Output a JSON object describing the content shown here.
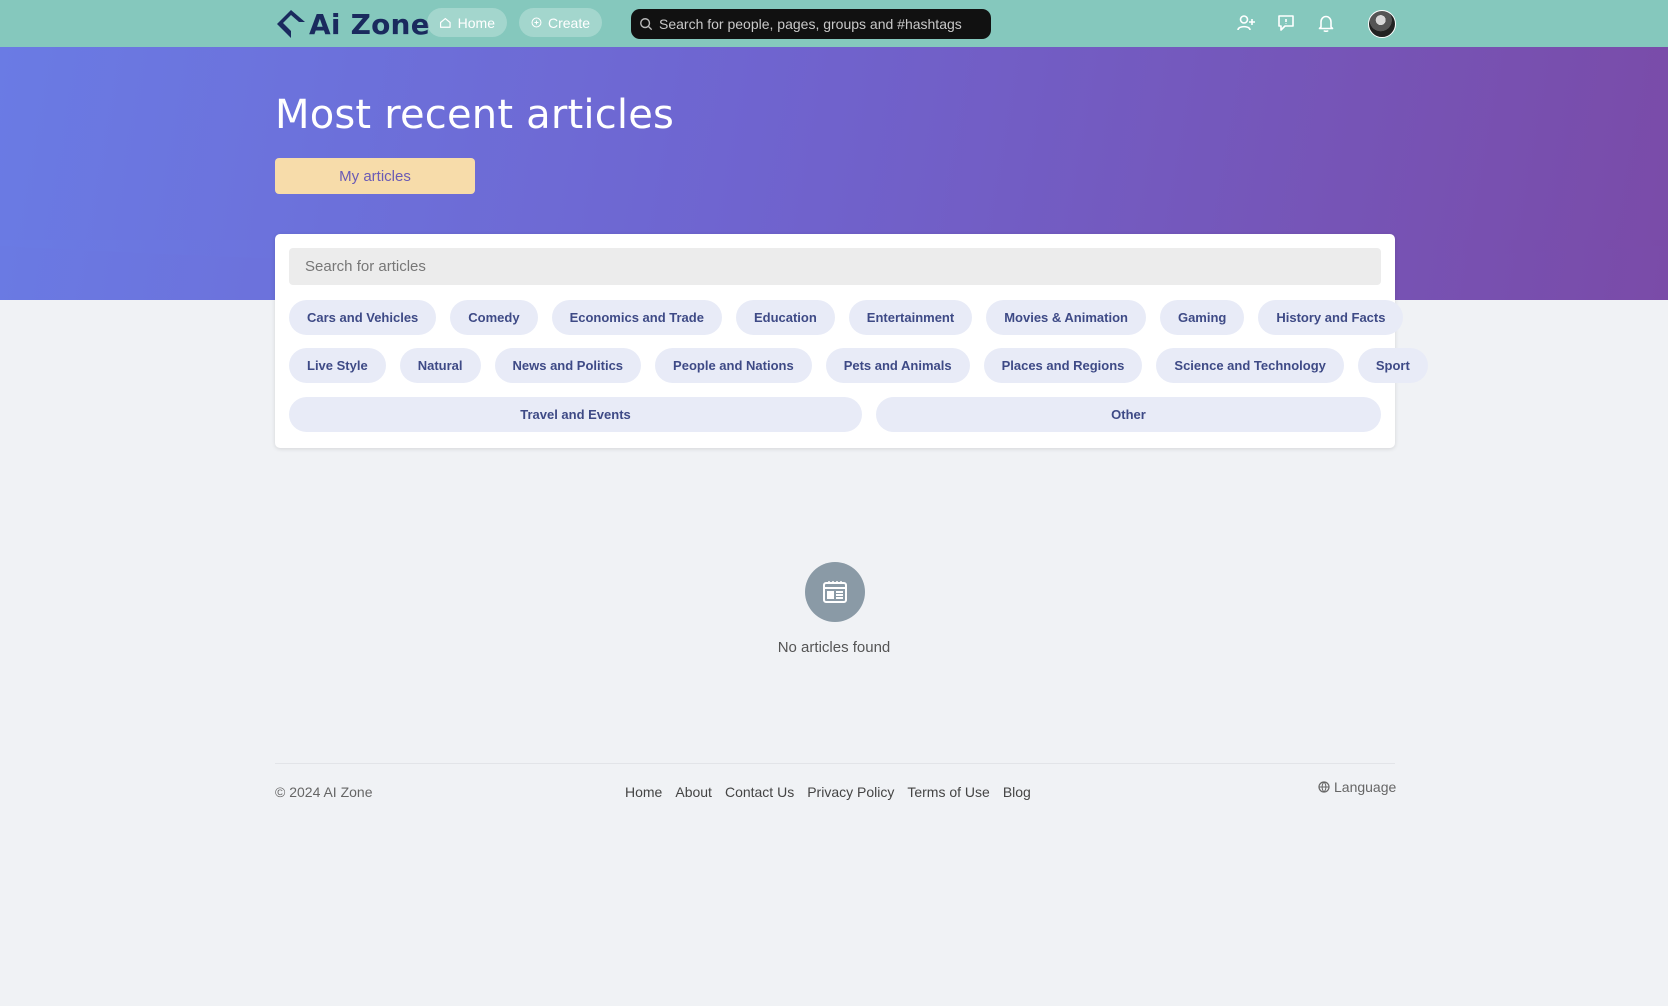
{
  "navbar": {
    "logo_text": "Ai Zone",
    "home_label": "Home",
    "create_label": "Create",
    "search_placeholder": "Search for people, pages, groups and #hashtags",
    "icons": [
      "add-user-icon",
      "chat-icon",
      "bell-icon"
    ],
    "bg_color": "#85c8bd"
  },
  "hero": {
    "title": "Most recent articles",
    "my_articles_label": "My articles",
    "gradient": [
      "#6a7be4",
      "#7a4ba8"
    ]
  },
  "filters": {
    "search_placeholder": "Search for articles",
    "categories_row1": [
      "Cars and Vehicles",
      "Comedy",
      "Economics and Trade",
      "Education",
      "Entertainment",
      "Movies & Animation",
      "Gaming",
      "History and Facts"
    ],
    "categories_row2": [
      "Live Style",
      "Natural",
      "News and Politics",
      "People and Nations",
      "Pets and Animals",
      "Places and Regions",
      "Science and Technology",
      "Sport"
    ],
    "categories_row3": [
      "Travel and Events",
      "Other"
    ]
  },
  "empty_state": {
    "icon": "article-icon",
    "message": "No articles found"
  },
  "footer": {
    "copyright": "© 2024 AI Zone",
    "links": [
      "Home",
      "About",
      "Contact Us",
      "Privacy Policy",
      "Terms of Use",
      "Blog"
    ],
    "language_label": "Language"
  }
}
